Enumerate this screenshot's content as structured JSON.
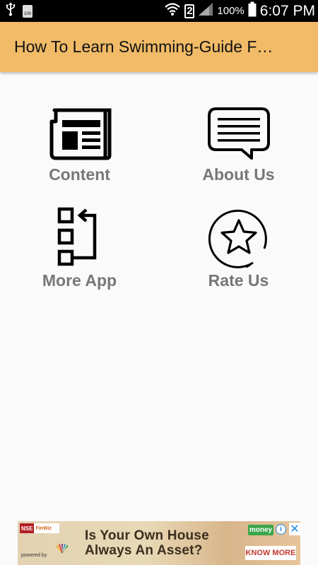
{
  "status_bar": {
    "sd_label": "100",
    "sim_number": "2",
    "battery_percent": "100%",
    "time": "6:07 PM",
    "icons": [
      "usb-icon",
      "sd-card-icon",
      "wifi-icon",
      "sim-badge",
      "signal-icon",
      "battery-icon"
    ]
  },
  "app_bar": {
    "title": "How To Learn Swimming-Guide F…",
    "background": "#f1bb68"
  },
  "menu": {
    "items": [
      {
        "label": "Content",
        "icon": "newspaper-icon"
      },
      {
        "label": "About Us",
        "icon": "chat-bubble-icon"
      },
      {
        "label": "More App",
        "icon": "apps-list-icon"
      },
      {
        "label": "Rate Us",
        "icon": "star-circle-icon"
      }
    ],
    "label_color": "#777777"
  },
  "ad": {
    "logo_nse": "NSE",
    "logo_partner": "FinWiz",
    "powered_by": "powered by",
    "headline_line1": "Is Your Own House",
    "headline_line2": "Always An Asset?",
    "brand": "money",
    "cta": "KNOW MORE",
    "info_glyph": "i",
    "close_glyph": "✕"
  }
}
